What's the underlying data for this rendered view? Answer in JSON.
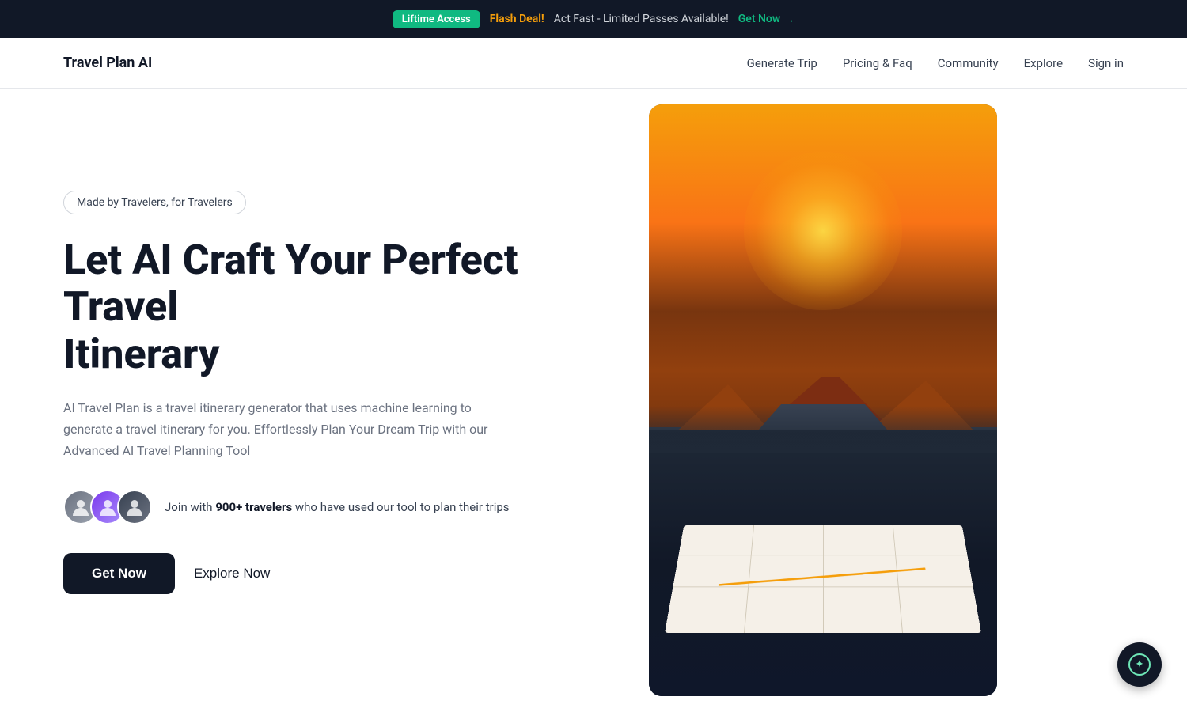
{
  "banner": {
    "badge_label": "Liftime Access",
    "flash_label": "Flash Deal!",
    "flash_text": "Act Fast - Limited Passes Available!",
    "cta_label": "Get Now",
    "cta_arrow": "→"
  },
  "nav": {
    "logo": "Travel Plan AI",
    "links": [
      {
        "label": "Generate Trip",
        "id": "generate-trip"
      },
      {
        "label": "Pricing & Faq",
        "id": "pricing-faq"
      },
      {
        "label": "Community",
        "id": "community"
      },
      {
        "label": "Explore",
        "id": "explore"
      }
    ],
    "signin": "Sign in"
  },
  "hero": {
    "badge": "Made by Travelers, for Travelers",
    "title_line1": "Let AI Craft Your Perfect Travel",
    "title_line2": "Itinerary",
    "description": "AI Travel Plan is a travel itinerary generator that uses machine learning to generate a travel itinerary for you. Effortlessly Plan Your Dream Trip with our Advanced AI Travel Planning Tool",
    "travelers_count": "900+ travelers",
    "travelers_prefix": "Join with",
    "travelers_suffix": "who have used our tool to plan their trips",
    "cta_primary": "Get Now",
    "cta_secondary": "Explore Now"
  }
}
